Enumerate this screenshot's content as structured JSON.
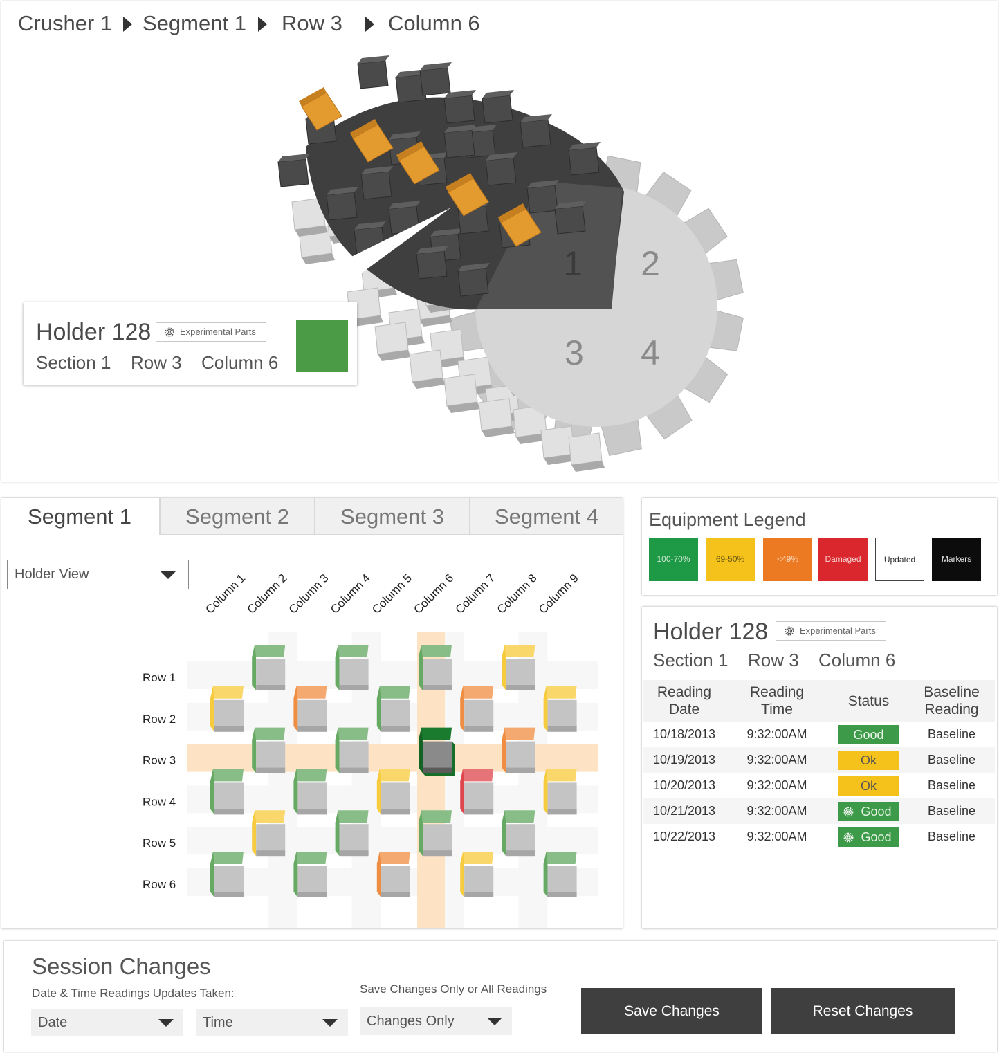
{
  "breadcrumb": {
    "items": [
      "Crusher 1",
      "Segment 1",
      "Row 3",
      "Column 6"
    ]
  },
  "drum": {
    "segment_numbers": [
      "1",
      "2",
      "3",
      "4"
    ]
  },
  "holder": {
    "title": "Holder 128",
    "badge": "Experimental Parts",
    "section": "Section 1",
    "row": "Row 3",
    "column": "Column 6",
    "status_color": "#4a9a46"
  },
  "tabs": [
    "Segment 1",
    "Segment 2",
    "Segment 3",
    "Segment 4"
  ],
  "view_select": {
    "value": "Holder View"
  },
  "grid": {
    "columns": [
      "Column 1",
      "Column 2",
      "Column 3",
      "Column 4",
      "Column 5",
      "Column 6",
      "Column 7",
      "Column 8",
      "Column 9"
    ],
    "rows": [
      "Row 1",
      "Row 2",
      "Row 3",
      "Row 4",
      "Row 5",
      "Row 6"
    ],
    "selected_row": "Row 3",
    "selected_column": "Column 6",
    "cells": [
      {
        "col": 2,
        "row": 1,
        "status": "good"
      },
      {
        "col": 4,
        "row": 1,
        "status": "good"
      },
      {
        "col": 6,
        "row": 1,
        "status": "good"
      },
      {
        "col": 8,
        "row": 1,
        "status": "ok"
      },
      {
        "col": 1,
        "row": 2,
        "status": "ok"
      },
      {
        "col": 3,
        "row": 2,
        "status": "low"
      },
      {
        "col": 5,
        "row": 2,
        "status": "good"
      },
      {
        "col": 7,
        "row": 2,
        "status": "low"
      },
      {
        "col": 9,
        "row": 2,
        "status": "ok"
      },
      {
        "col": 2,
        "row": 3,
        "status": "good"
      },
      {
        "col": 4,
        "row": 3,
        "status": "good"
      },
      {
        "col": 6,
        "row": 3,
        "status": "selected"
      },
      {
        "col": 8,
        "row": 3,
        "status": "low"
      },
      {
        "col": 1,
        "row": 4,
        "status": "good"
      },
      {
        "col": 3,
        "row": 4,
        "status": "good"
      },
      {
        "col": 5,
        "row": 4,
        "status": "ok"
      },
      {
        "col": 7,
        "row": 4,
        "status": "damaged"
      },
      {
        "col": 9,
        "row": 4,
        "status": "ok"
      },
      {
        "col": 2,
        "row": 5,
        "status": "ok"
      },
      {
        "col": 4,
        "row": 5,
        "status": "good"
      },
      {
        "col": 6,
        "row": 5,
        "status": "good"
      },
      {
        "col": 8,
        "row": 5,
        "status": "good"
      },
      {
        "col": 1,
        "row": 6,
        "status": "good"
      },
      {
        "col": 3,
        "row": 6,
        "status": "good"
      },
      {
        "col": 5,
        "row": 6,
        "status": "low"
      },
      {
        "col": 7,
        "row": 6,
        "status": "ok"
      },
      {
        "col": 9,
        "row": 6,
        "status": "good"
      }
    ]
  },
  "legend": {
    "title": "Equipment Legend",
    "items": [
      {
        "label": "100-70%",
        "bg": "#1e9a47",
        "fg": "#cfe8d2"
      },
      {
        "label": "69-50%",
        "bg": "#f5c21c",
        "fg": "#6b5a12"
      },
      {
        "label": "<49%",
        "bg": "#ec7a22",
        "fg": "#f8d9bf"
      },
      {
        "label": "Damaged",
        "bg": "#d9272d",
        "fg": "#f5d0d0"
      },
      {
        "label": "Updated",
        "bg": "#ffffff",
        "fg": "#333333"
      },
      {
        "label": "Markers",
        "bg": "#0c0c0c",
        "fg": "#e0e0e0"
      }
    ]
  },
  "readings": {
    "headers": [
      "Reading\nDate",
      "Reading\nTime",
      "Status",
      "Baseline\nReading"
    ],
    "rows": [
      {
        "date": "10/18/2013",
        "time": "9:32:00AM",
        "status": "Good",
        "gear": false,
        "baseline": "Baseline"
      },
      {
        "date": "10/19/2013",
        "time": "9:32:00AM",
        "status": "Ok",
        "gear": false,
        "baseline": "Baseline"
      },
      {
        "date": "10/20/2013",
        "time": "9:32:00AM",
        "status": "Ok",
        "gear": false,
        "baseline": "Baseline"
      },
      {
        "date": "10/21/2013",
        "time": "9:32:00AM",
        "status": "Good",
        "gear": true,
        "baseline": "Baseline"
      },
      {
        "date": "10/22/2013",
        "time": "9:32:00AM",
        "status": "Good",
        "gear": true,
        "baseline": "Baseline"
      }
    ]
  },
  "session": {
    "title": "Session Changes",
    "datetime_label": "Date & Time Readings Updates Taken:",
    "date_value": "Date",
    "time_value": "Time",
    "save_mode_label": "Save Changes Only or All Readings",
    "save_mode_value": "Changes Only",
    "save_button": "Save Changes",
    "reset_button": "Reset Changes"
  },
  "colors": {
    "good": "#4a9a46",
    "ok": "#f5c21c",
    "low": "#ec7a22",
    "damaged": "#d9272d",
    "highlight": "#fde3c4",
    "drum_dark": "#525252",
    "drum_light": "#d6d6d6",
    "marker": "#e39a2f"
  }
}
